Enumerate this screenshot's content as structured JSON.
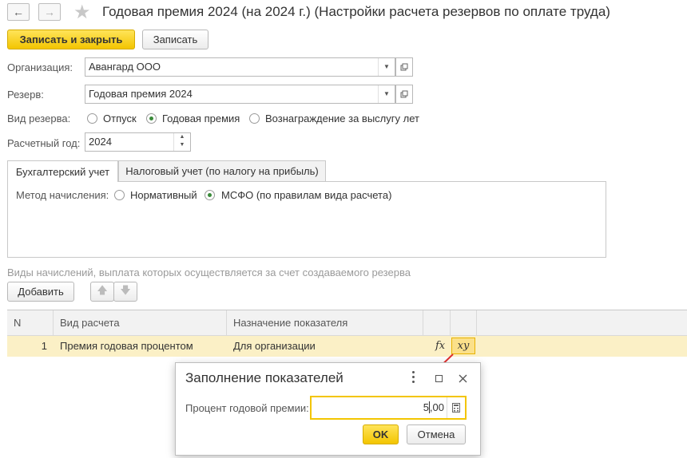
{
  "window": {
    "title": "Годовая премия 2024 (на 2024 г.) (Настройки расчета резервов по оплате труда)",
    "back_icon": "←",
    "forward_icon": "→",
    "star_icon": "★"
  },
  "toolbar": {
    "save_close_label": "Записать и закрыть",
    "save_label": "Записать"
  },
  "form": {
    "org_label": "Организация:",
    "org_value": "Авангард ООО",
    "reserve_label": "Резерв:",
    "reserve_value": "Годовая премия 2024",
    "type_label": "Вид резерва:",
    "type_options": [
      "Отпуск",
      "Годовая премия",
      "Вознаграждение за выслугу лет"
    ],
    "type_selected": "Годовая премия",
    "year_label": "Расчетный год:",
    "year_value": "2024"
  },
  "tabs": [
    "Бухгалтерский учет",
    "Налоговый учет (по налогу на прибыль)"
  ],
  "accounting": {
    "method_label": "Метод начисления:",
    "method_options": [
      "Нормативный",
      "МСФО (по правилам вида расчета)"
    ],
    "method_selected": "МСФО (по правилам вида расчета)"
  },
  "accruals": {
    "section_title": "Виды начислений, выплата которых осуществляется за счет создаваемого резерва",
    "add_label": "Добавить",
    "columns": [
      "N",
      "Вид расчета",
      "Назначение показателя"
    ],
    "rows": [
      {
        "n": "1",
        "type": "Премия годовая процентом",
        "purpose": "Для организации",
        "fx": "fx",
        "xy": "xy"
      }
    ]
  },
  "dialog": {
    "title": "Заполнение показателей",
    "field_label": "Процент годовой премии:",
    "field_value_int": "5",
    "field_value_frac": ",00",
    "ok_label": "OK",
    "cancel_label": "Отмена"
  },
  "colors": {
    "accent_yellow": "#f3c500",
    "row_highlight": "#fbf0c6",
    "arrow_red": "#e03030",
    "radio_green": "#3a8a3a"
  }
}
